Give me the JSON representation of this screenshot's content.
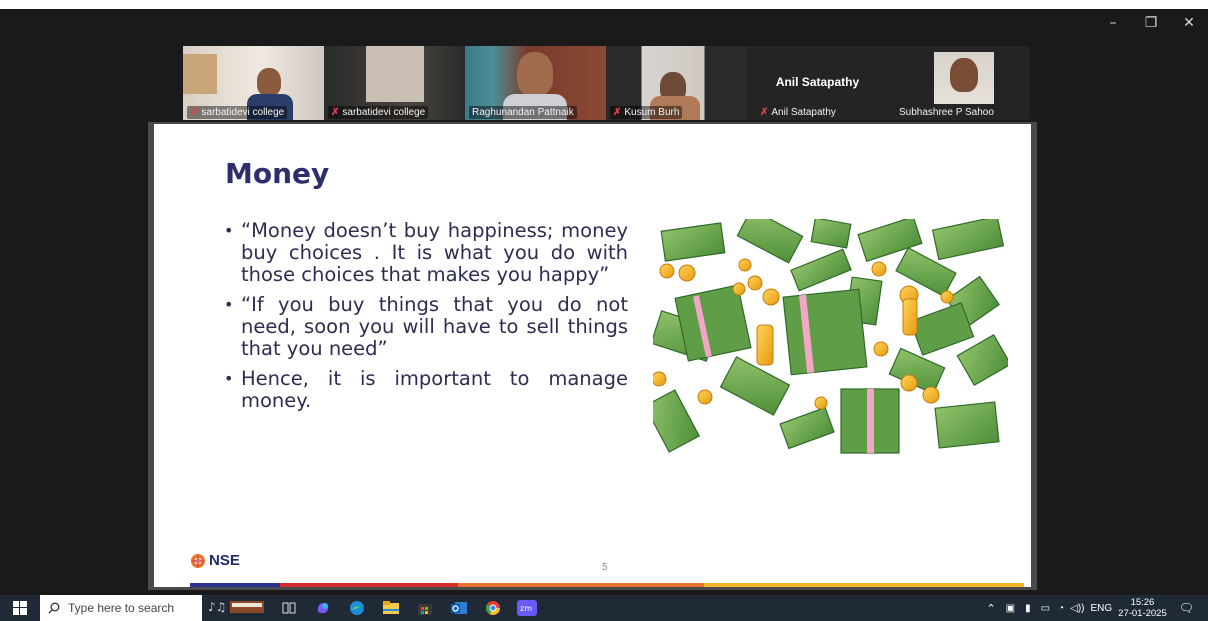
{
  "window": {
    "controls": {
      "minimize": "–",
      "restore": "❐",
      "close": "✕"
    }
  },
  "participants": [
    {
      "name": "sarbatidevi college",
      "muted": true
    },
    {
      "name": "sarbatidevi college",
      "muted": true
    },
    {
      "name": "Raghunandan Pattnaik",
      "muted": false,
      "active_speaker": true
    },
    {
      "name": "Kusum Burh",
      "muted": true
    },
    {
      "name": "Anil Satapathy",
      "muted": true,
      "center_label": "Anil Satapathy"
    },
    {
      "name": "Subhashree P Sahoo",
      "muted": false
    }
  ],
  "slide": {
    "title": "Money",
    "bullets": [
      "“Money doesn’t buy happiness; money buy choices . It is what you do with those choices that makes you happy”",
      "“If you buy things that you do not need, soon you will have to sell things that you need”",
      "Hence, it is important to manage money."
    ],
    "logo_text": "NSE",
    "page_number": "5",
    "footer_colors": [
      "#2e3192",
      "#d32f2f",
      "#e8732a",
      "#f0b429"
    ]
  },
  "taskbar": {
    "search_placeholder": "Type here to search",
    "language": "ENG",
    "time": "15:26",
    "date": "27-01-2025"
  }
}
